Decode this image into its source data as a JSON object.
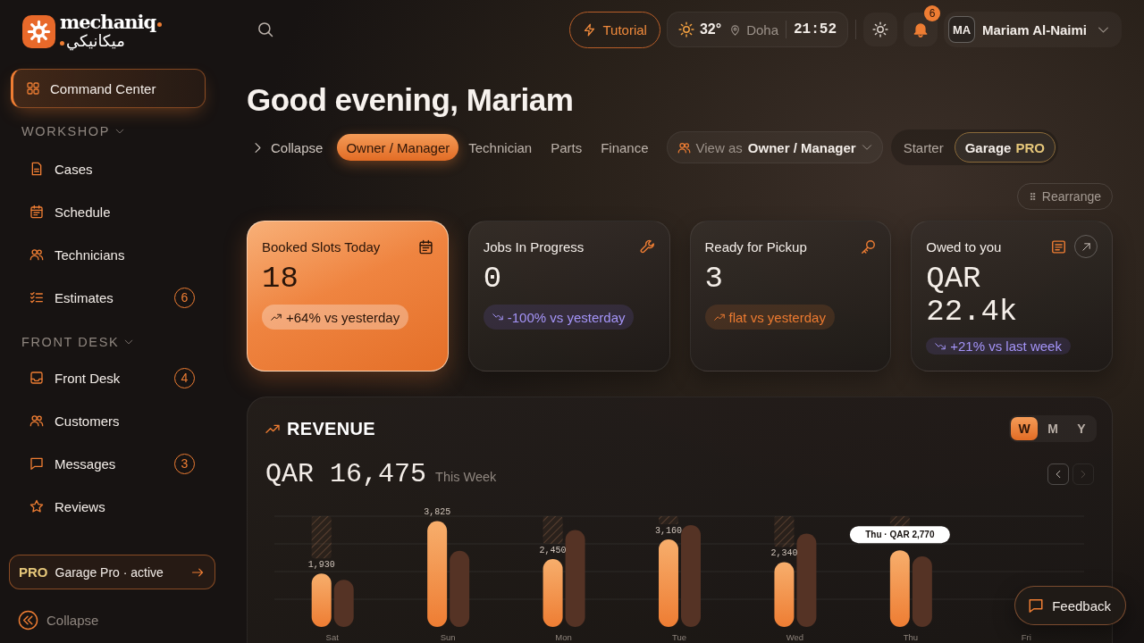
{
  "sidebar": {
    "brand": {
      "name": "mechaniq",
      "name_arabic": "ميكانيكي"
    },
    "main_item": {
      "label": "Command Center",
      "selected": true
    },
    "sections": [
      {
        "title": "WORKSHOP",
        "expanded": true,
        "items": [
          {
            "label": "Cases",
            "selected": false
          },
          {
            "label": "Schedule",
            "selected": false
          },
          {
            "label": "Technicians",
            "selected": false
          },
          {
            "label": "Estimates",
            "selected": false,
            "badge": "6"
          }
        ]
      },
      {
        "title": "FRONT DESK",
        "expanded": true,
        "items": [
          {
            "label": "Front Desk",
            "selected": false,
            "badge": "4"
          },
          {
            "label": "Customers",
            "selected": false
          },
          {
            "label": "Messages",
            "selected": false,
            "badge": "3"
          },
          {
            "label": "Reviews",
            "selected": false
          }
        ]
      }
    ],
    "plan_card": {
      "tag": "PRO",
      "label": "Garage Pro · active"
    },
    "collapse": "Collapse"
  },
  "top_bar": {
    "tutorial": "Tutorial",
    "weather": {
      "temperature": "32°",
      "location": "Doha",
      "time": "21:52"
    },
    "notifications": {
      "count": "6"
    },
    "user": {
      "initials": "MA",
      "name": "Mariam Al-Naimi"
    }
  },
  "greeting": "Good evening, Mariam",
  "toolbar": {
    "collapse": "Collapse",
    "roles": [
      {
        "label": "Owner / Manager",
        "selected": true
      },
      {
        "label": "Technician",
        "selected": false
      },
      {
        "label": "Parts",
        "selected": false
      },
      {
        "label": "Finance",
        "selected": false
      }
    ],
    "view_as": {
      "label": "View as",
      "value": "Owner / Manager"
    },
    "plans": [
      {
        "label": "Starter",
        "selected": false
      },
      {
        "label": "Garage",
        "tag": "PRO",
        "selected": true
      }
    ],
    "rearrange": "Rearrange"
  },
  "kpis": [
    {
      "title": "Booked Slots Today",
      "value": "18",
      "delta": "+64% vs yesterday",
      "falling": false,
      "highlighted": true,
      "open_link": false
    },
    {
      "title": "Jobs In Progress",
      "value": "0",
      "delta": "-100% vs yesterday",
      "falling": true,
      "highlighted": false,
      "open_link": false
    },
    {
      "title": "Ready for Pickup",
      "value": "3",
      "delta": "flat vs yesterday",
      "falling": false,
      "highlighted": false,
      "open_link": false
    },
    {
      "title": "Owed to you",
      "value": "QAR 22.4k",
      "delta": "+21% vs last week",
      "falling": true,
      "highlighted": false,
      "open_link": true
    }
  ],
  "revenue": {
    "title": "REVENUE",
    "periods": [
      {
        "label": "W",
        "selected": true
      },
      {
        "label": "M",
        "selected": false
      },
      {
        "label": "Y",
        "selected": false
      }
    ],
    "total": "QAR 16,475",
    "total_caption": "This Week",
    "nav": [
      {
        "kind": "previous",
        "disabled": false
      },
      {
        "kind": "next",
        "disabled": true
      }
    ],
    "chart_data": {
      "type": "bar",
      "categories": [
        "Sat",
        "Sun",
        "Mon",
        "Tue",
        "Wed",
        "Thu",
        "Fri"
      ],
      "series": [
        {
          "color": "#ee7d33",
          "values": [
            1930,
            3825,
            2450,
            3160,
            2340,
            2770,
            null
          ],
          "value_labels": [
            "1,930",
            "3,825",
            "2,450",
            "3,160",
            "2,340",
            null,
            null
          ]
        },
        {
          "color": "#553325",
          "values": [
            1700,
            2750,
            3500,
            3680,
            3370,
            2550,
            null
          ]
        }
      ],
      "annotations": [
        "Thu · QAR 2,770"
      ]
    }
  },
  "feedback": "Feedback"
}
